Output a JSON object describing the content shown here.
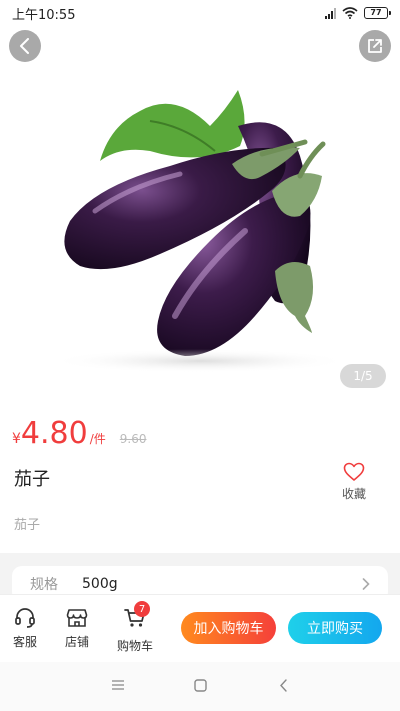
{
  "status_bar": {
    "time": "上午10:55",
    "battery": "77"
  },
  "hero": {
    "image_counter": "1/5",
    "image_subject": "eggplant"
  },
  "product": {
    "price_symbol": "¥",
    "price": "4.80",
    "unit": "/件",
    "original_price": "9.60",
    "title": "茄子",
    "subtitle": "茄子",
    "favorite_label": "收藏"
  },
  "spec": {
    "label": "规格",
    "value": "500g"
  },
  "action_bar": {
    "service_label": "客服",
    "store_label": "店铺",
    "cart_label": "购物车",
    "cart_count": "7",
    "add_to_cart_label": "加入购物车",
    "buy_now_label": "立即购买"
  },
  "colors": {
    "price": "#f03d3d",
    "add_to_cart_gradient": [
      "#ff8a1e",
      "#f5403a"
    ],
    "buy_now_gradient": [
      "#1fd0ea",
      "#13a7ee"
    ]
  },
  "icons": [
    "back-icon",
    "share-icon",
    "heart-icon",
    "headset-icon",
    "store-icon",
    "cart-icon",
    "chevron-right-icon",
    "menu-icon",
    "home-icon",
    "back-nav-icon"
  ]
}
